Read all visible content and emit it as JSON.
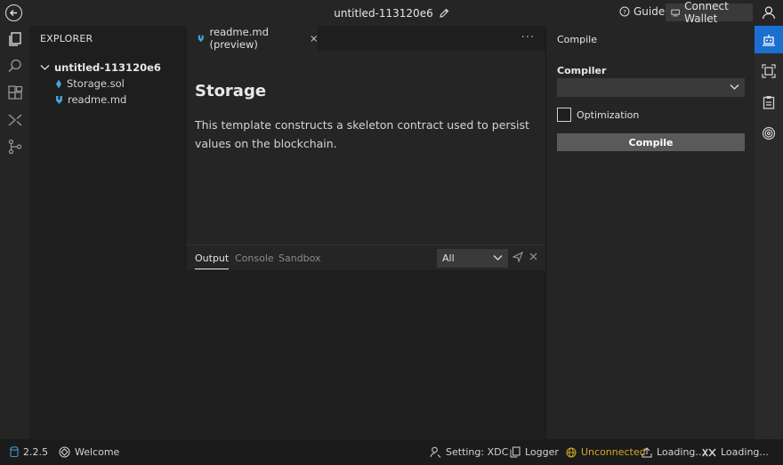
{
  "titlebar": {
    "project_title": "untitled-113120e6",
    "guide_label": "Guide",
    "connect_wallet_label": "Connect Wallet"
  },
  "activitybar": {
    "items": [
      "explorer-icon",
      "search-icon",
      "extensions-icon",
      "split-icon",
      "source-control-icon"
    ]
  },
  "explorer": {
    "title": "EXPLORER",
    "root_folder": "untitled-113120e6",
    "files": [
      {
        "name": "Storage.sol",
        "icon": "file-icon"
      },
      {
        "name": "readme.md",
        "icon": "markdown-icon"
      }
    ]
  },
  "editor": {
    "tab_label": "readme.md (preview)",
    "more_label": "···",
    "heading": "Storage",
    "paragraph": "This template constructs a skeleton contract used to persist values on the blockchain."
  },
  "panel": {
    "tabs": [
      "Output",
      "Console",
      "Sandbox"
    ],
    "active_tab": "Output",
    "filter_value": "All"
  },
  "compile_panel": {
    "title": "Compile",
    "compiler_label": "Compiler",
    "compiler_value": "",
    "optimization_label": "Optimization",
    "compile_button": "Compile"
  },
  "statusbar": {
    "version": "2.2.5",
    "welcome": "Welcome",
    "setting": "Setting: XDC",
    "logger": "Logger",
    "connection": "Unconnected",
    "loading_1": "Loading...",
    "loading_2": "Loading..."
  },
  "colors": {
    "accent": "#1a6fd1",
    "warning": "#d4a72c",
    "file_icon": "#4aa3df"
  }
}
